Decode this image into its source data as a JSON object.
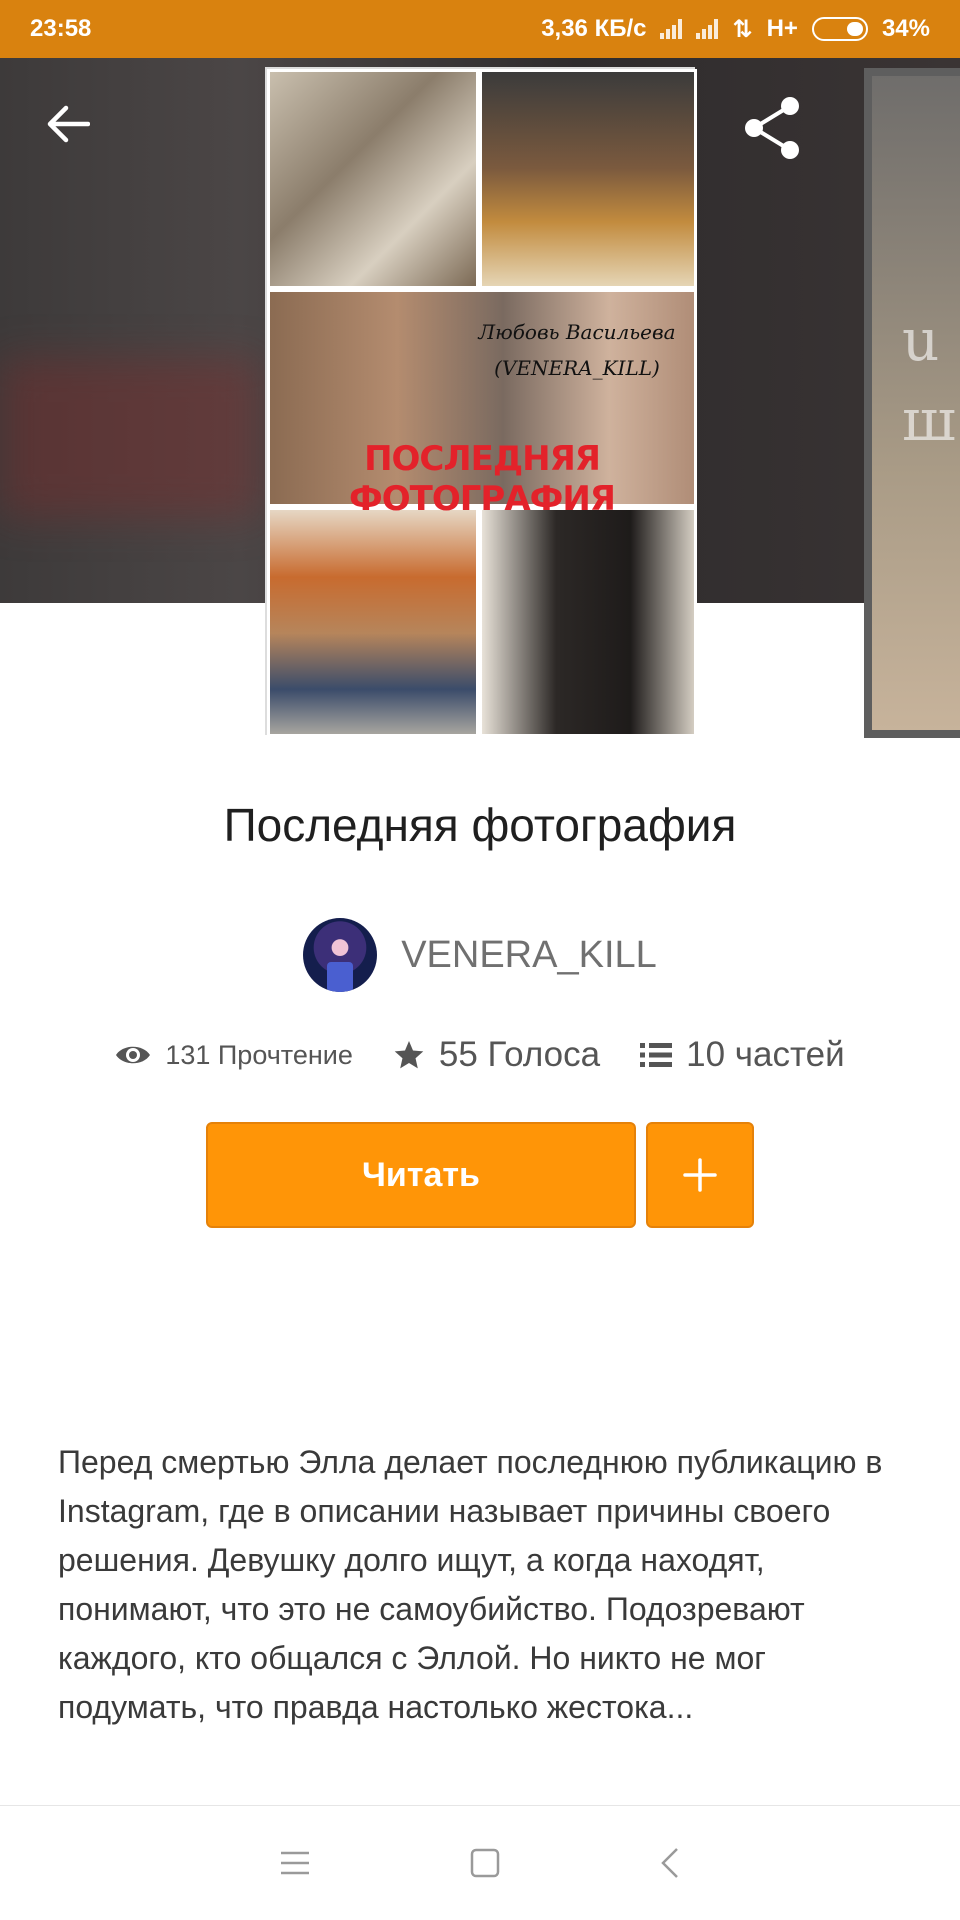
{
  "status_bar": {
    "time": "23:58",
    "network_speed": "3,36 КБ/с",
    "network_type": "H+",
    "battery": "34%"
  },
  "header": {
    "back_icon": "arrow-left-icon",
    "share_icon": "share-icon",
    "more_icon": "more-vertical-icon"
  },
  "cover": {
    "author_line1": "Любовь Васильева",
    "author_line2": "(VENERA_KILL)",
    "title": "ПОСЛЕДНЯЯ ФОТОГРАФИЯ"
  },
  "side_cover_text": [
    "u",
    "ш"
  ],
  "book": {
    "title": "Последняя фотография"
  },
  "author": {
    "name": "VENERA_KILL"
  },
  "stats": {
    "reads": "131 Прочтение",
    "votes": "55 Голоса",
    "parts": "10 частей"
  },
  "actions": {
    "read_label": "Читать",
    "add_icon": "plus-icon"
  },
  "description": "Перед смертью Элла делает последнюю публикацию в Instagram, где в описании называет причины своего решения. Девушку долго ищут, а когда находят, понимают, что это не самоубийство. Подозревают каждого, кто общался с Эллой. Но никто не мог подумать, что правда настолько жестока...",
  "nav": {
    "menu_icon": "menu-icon",
    "home_icon": "home-square-icon",
    "back_icon": "back-chevron-icon"
  },
  "colors": {
    "status_bar": "#d9820f",
    "accent": "#ff9507"
  }
}
